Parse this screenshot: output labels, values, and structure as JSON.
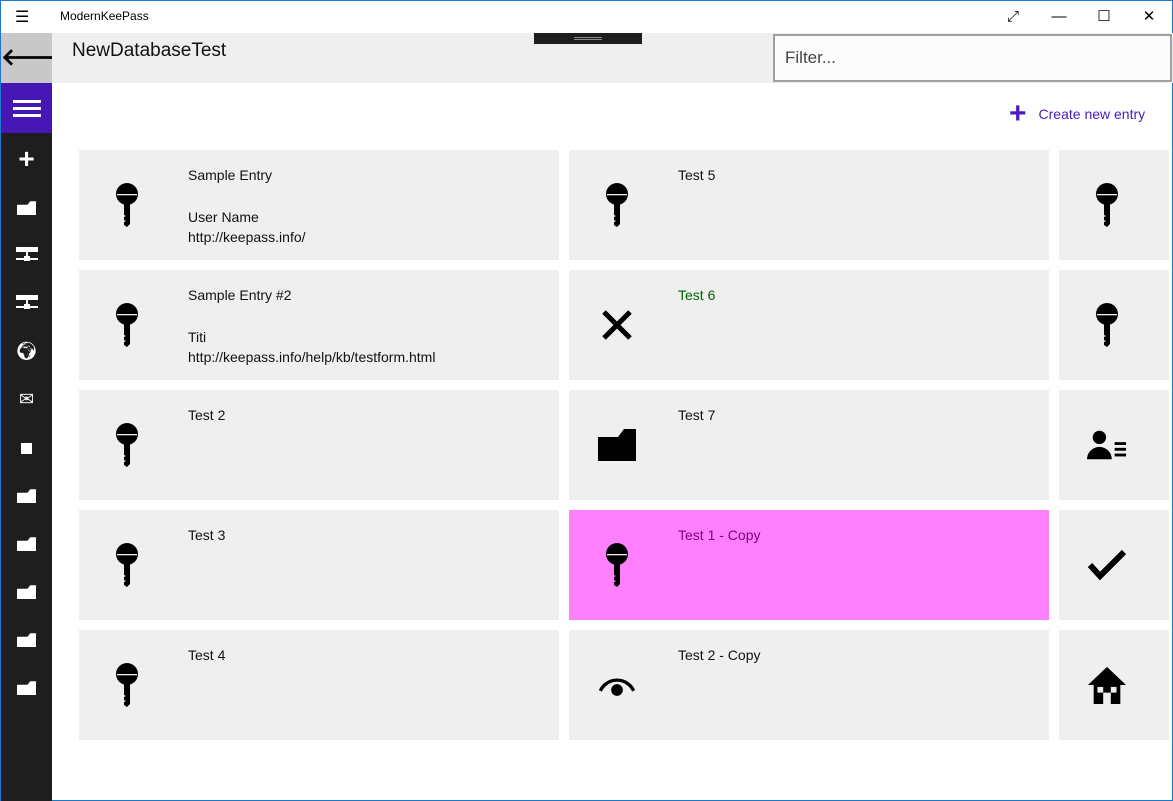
{
  "window": {
    "title": "ModernKeePass",
    "menu_icon": "hamburger-icon",
    "controls": [
      "expand-icon",
      "minimize-icon",
      "maximize-icon",
      "close-icon"
    ]
  },
  "sidebar": {
    "back": "back-arrow-icon",
    "menu": "hamburger-icon",
    "items": [
      "add-icon",
      "folder-icon",
      "network-icon",
      "network-icon",
      "globe-icon",
      "mail-icon",
      "square-icon",
      "folder-icon",
      "folder-icon",
      "folder-icon",
      "folder-icon",
      "folder-icon"
    ]
  },
  "header": {
    "title": "NewDatabaseTest",
    "filter_placeholder": "Filter..."
  },
  "create": {
    "label": "Create new entry",
    "icon": "plus-icon"
  },
  "colors": {
    "accent": "#4617b4",
    "tile": "#efefef",
    "highlight": "#ff80ff",
    "highlight_text": "#800080",
    "green_text": "#006400"
  },
  "entries": [
    {
      "title": "Sample Entry",
      "user": "User Name",
      "url": "http://keepass.info/",
      "icon": "key-icon"
    },
    {
      "title": "Test 5",
      "icon": "key-icon"
    },
    {
      "title": "",
      "icon": "key-icon"
    },
    {
      "title": "Sample Entry #2",
      "user": "Titi",
      "url": "http://keepass.info/help/kb/testform.html",
      "icon": "key-icon"
    },
    {
      "title": "Test 6",
      "icon": "close-x-icon",
      "color": "#006400"
    },
    {
      "title": "",
      "icon": "key-icon"
    },
    {
      "title": "Test 2",
      "icon": "key-icon"
    },
    {
      "title": "Test 7",
      "icon": "folder-icon"
    },
    {
      "title": "",
      "icon": "contact-card-icon"
    },
    {
      "title": "Test 3",
      "icon": "key-icon"
    },
    {
      "title": "Test 1 - Copy",
      "icon": "key-icon",
      "bg": "#ff80ff",
      "color": "#800080"
    },
    {
      "title": "",
      "icon": "checkmark-icon"
    },
    {
      "title": "Test 4",
      "icon": "key-icon"
    },
    {
      "title": "Test 2 - Copy",
      "icon": "eye-icon"
    },
    {
      "title": "",
      "icon": "home-icon"
    }
  ]
}
